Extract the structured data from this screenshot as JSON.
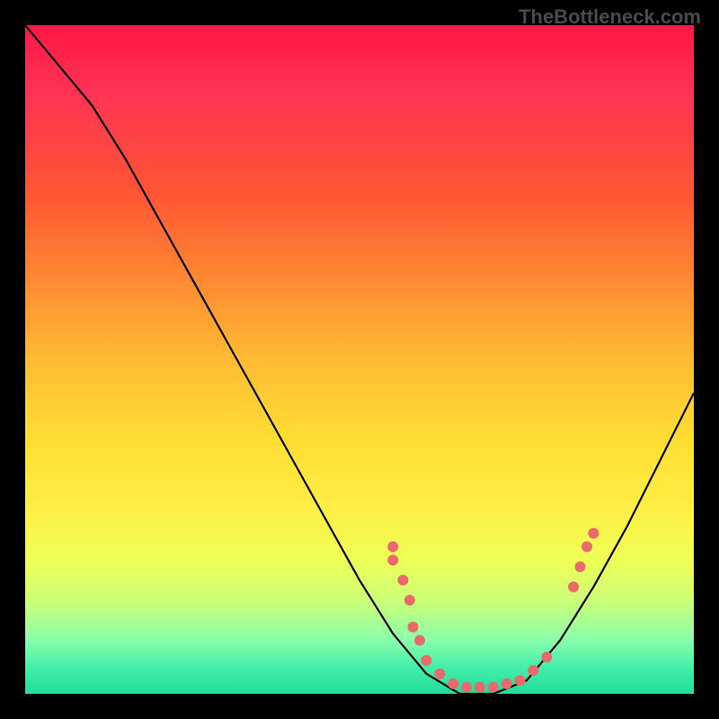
{
  "watermark": "TheBottleneck.com",
  "chart_data": {
    "type": "line",
    "title": "",
    "xlabel": "",
    "ylabel": "",
    "xlim": [
      0,
      100
    ],
    "ylim": [
      0,
      100
    ],
    "curve": {
      "name": "bottleneck-curve",
      "points": [
        {
          "x": 0,
          "y": 100
        },
        {
          "x": 5,
          "y": 94
        },
        {
          "x": 10,
          "y": 88
        },
        {
          "x": 15,
          "y": 80
        },
        {
          "x": 20,
          "y": 71
        },
        {
          "x": 25,
          "y": 62
        },
        {
          "x": 30,
          "y": 53
        },
        {
          "x": 35,
          "y": 44
        },
        {
          "x": 40,
          "y": 35
        },
        {
          "x": 45,
          "y": 26
        },
        {
          "x": 50,
          "y": 17
        },
        {
          "x": 55,
          "y": 9
        },
        {
          "x": 60,
          "y": 3
        },
        {
          "x": 65,
          "y": 0
        },
        {
          "x": 70,
          "y": 0
        },
        {
          "x": 75,
          "y": 2
        },
        {
          "x": 80,
          "y": 8
        },
        {
          "x": 85,
          "y": 16
        },
        {
          "x": 90,
          "y": 25
        },
        {
          "x": 95,
          "y": 35
        },
        {
          "x": 100,
          "y": 45
        }
      ]
    },
    "scatter": {
      "name": "data-points",
      "color": "#e86a6a",
      "points": [
        {
          "x": 55,
          "y": 22
        },
        {
          "x": 55,
          "y": 20
        },
        {
          "x": 56.5,
          "y": 17
        },
        {
          "x": 57.5,
          "y": 14
        },
        {
          "x": 58,
          "y": 10
        },
        {
          "x": 59,
          "y": 8
        },
        {
          "x": 60,
          "y": 5
        },
        {
          "x": 62,
          "y": 3
        },
        {
          "x": 64,
          "y": 1.5
        },
        {
          "x": 66,
          "y": 1
        },
        {
          "x": 68,
          "y": 1
        },
        {
          "x": 70,
          "y": 1
        },
        {
          "x": 72,
          "y": 1.5
        },
        {
          "x": 74,
          "y": 2
        },
        {
          "x": 76,
          "y": 3.5
        },
        {
          "x": 78,
          "y": 5.5
        },
        {
          "x": 82,
          "y": 16
        },
        {
          "x": 83,
          "y": 19
        },
        {
          "x": 84,
          "y": 22
        },
        {
          "x": 85,
          "y": 24
        }
      ]
    }
  }
}
